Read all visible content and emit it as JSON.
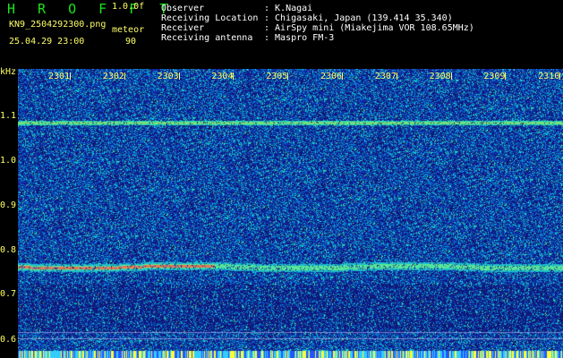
{
  "header": {
    "logo": "H R O F F T",
    "version": "1.0.0f",
    "filename": "KN9_2504292300.png",
    "meteor_label": "meteor",
    "datetime": "25.04.29 23:00",
    "meteor_count": "90",
    "info": [
      {
        "label": "Observer",
        "value": ": K.Nagai"
      },
      {
        "label": "Receiving Location",
        "value": ": Chigasaki, Japan (139.414 35.340)"
      },
      {
        "label": "Receiver",
        "value": ": AirSpy mini (Miakejima VOR 108.65MHz)"
      },
      {
        "label": "Receiving antenna",
        "value": ": Maspro FM-3"
      }
    ]
  },
  "axis": {
    "y_unit": "kHz",
    "x_ticks": [
      "2301",
      "2302",
      "2303",
      "2304",
      "2305",
      "2306",
      "2307",
      "2308",
      "2309",
      "2310"
    ],
    "y_ticks": [
      "1.1",
      "1.0",
      "0.9",
      "0.8",
      "0.7",
      "0.6"
    ]
  },
  "colors": {
    "background": "#000000",
    "label_yellow": "#ffff66",
    "logo_green": "#19e619",
    "noise_base": "#1a2a9a"
  }
}
